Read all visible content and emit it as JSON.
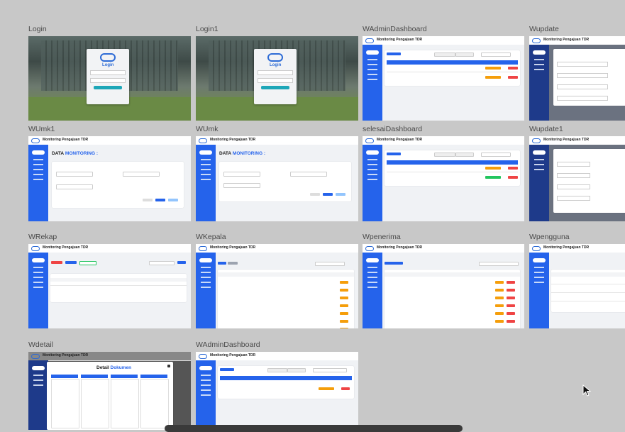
{
  "frames": [
    {
      "id": "login",
      "label": "Login",
      "kind": "login"
    },
    {
      "id": "login1",
      "label": "Login1",
      "kind": "login"
    },
    {
      "id": "wadmin1",
      "label": "WAdminDashboard",
      "kind": "dashboard"
    },
    {
      "id": "wupdate",
      "label": "Wupdate",
      "kind": "update"
    },
    {
      "id": "wumk1",
      "label": "WUmk1",
      "kind": "form"
    },
    {
      "id": "wumk",
      "label": "WUmk",
      "kind": "form"
    },
    {
      "id": "selesai",
      "label": "selesaiDashboard",
      "kind": "dashboard"
    },
    {
      "id": "wupdate1",
      "label": "Wupdate1",
      "kind": "update"
    },
    {
      "id": "wrekap",
      "label": "WRekap",
      "kind": "rekap"
    },
    {
      "id": "wkepala",
      "label": "WKepala",
      "kind": "list"
    },
    {
      "id": "wpenerima",
      "label": "Wpenerima",
      "kind": "list"
    },
    {
      "id": "wpengguna",
      "label": "Wpengguna",
      "kind": "list"
    },
    {
      "id": "wdetail",
      "label": "Wdetail",
      "kind": "detail"
    },
    {
      "id": "wadmin2",
      "label": "WAdminDashboard",
      "kind": "dashboard"
    }
  ],
  "thumb_text": {
    "app_title": "Monitoring Pengajuan TDR",
    "login_title": "Login",
    "data_monitoring_prefix": "DATA",
    "data_monitoring_accent": "MONITORING :",
    "detail_prefix": "Detail",
    "detail_accent": "Dokumen"
  }
}
